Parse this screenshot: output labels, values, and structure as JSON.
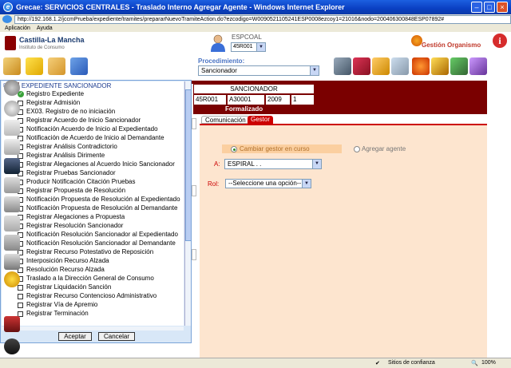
{
  "window": {
    "title": "Grecae: SERVICIOS CENTRALES - Traslado Interno Agregar Agente - Windows Internet Explorer",
    "url": "http://192.168.1.2/jccmPrueba/expediente/tramites/prepararNuevoTramiteAction.do?ezcodigo=W0090521105241ESP0008ezcoy1=21016&nodo=200406300848ESP07892#"
  },
  "menubar": {
    "items": [
      "Aplicación",
      "Ayuda"
    ]
  },
  "header": {
    "logo_text": "Castilla-La Mancha",
    "logo_sub": "Instituto de Consumo",
    "user_label": "ESPCOAL",
    "user_select": "45R001",
    "org_label": "Gestión Organismo"
  },
  "procedure": {
    "label": "Procedimiento:",
    "value": "Sancionador"
  },
  "case": {
    "title": "SANCIONADOR",
    "cells": [
      "45R001",
      "A30001",
      "2009",
      "1"
    ],
    "status": "Formalizado"
  },
  "tabs": [
    "Comunicación",
    "Gestor"
  ],
  "form": {
    "option_change": "Cambiar gestor en curso",
    "option_add": "Agregar agente",
    "a_label": "A:",
    "a_value": "ESPIRAL . .",
    "rol_label": "Rol:",
    "rol_value": "--Seleccione una opción--"
  },
  "tree": {
    "root": "EXPEDIENTE SANCIONADOR",
    "items": [
      "Registro Expediente",
      "Registrar Admisión",
      "EX03. Registro de no iniciación",
      "Registrar Acuerdo de Inicio Sancionador",
      "Notificación Acuerdo de Inicio al Expedientado",
      "Notificación de Acuerdo de Inicio al Demandante",
      "Registrar Análisis Contradictorio",
      "Registrar Análisis Dirimente",
      "Registrar Alegaciones al Acuerdo Inicio Sancionador",
      "Registrar Pruebas Sancionador",
      "Producir Notificación Citación Pruebas",
      "Registrar Propuesta de Resolución",
      "Notificación Propuesta de Resolución al Expedientado",
      "Notificación Propuesta de Resolución al Demandante",
      "Registrar Alegaciones a Propuesta",
      "Registrar Resolución Sancionador",
      "Notificación Resolución Sancionador al Expedientado",
      "Notificación Resolución Sancionador al Demandante",
      "Registrar Recurso Potestativo de Reposición",
      "Interposición Recurso Alzada",
      "Resolución Recurso Alzada",
      "Traslado a la Dirección General de Consumo",
      "Registrar Liquidación Sanción",
      "Registrar Recurso Contencioso Administrativo",
      "Registrar Vía de Apremio",
      "Registrar Terminación"
    ],
    "accept": "Aceptar",
    "cancel": "Cancelar"
  },
  "status": {
    "zone": "Sitios de confianza",
    "zoom": "100%"
  }
}
